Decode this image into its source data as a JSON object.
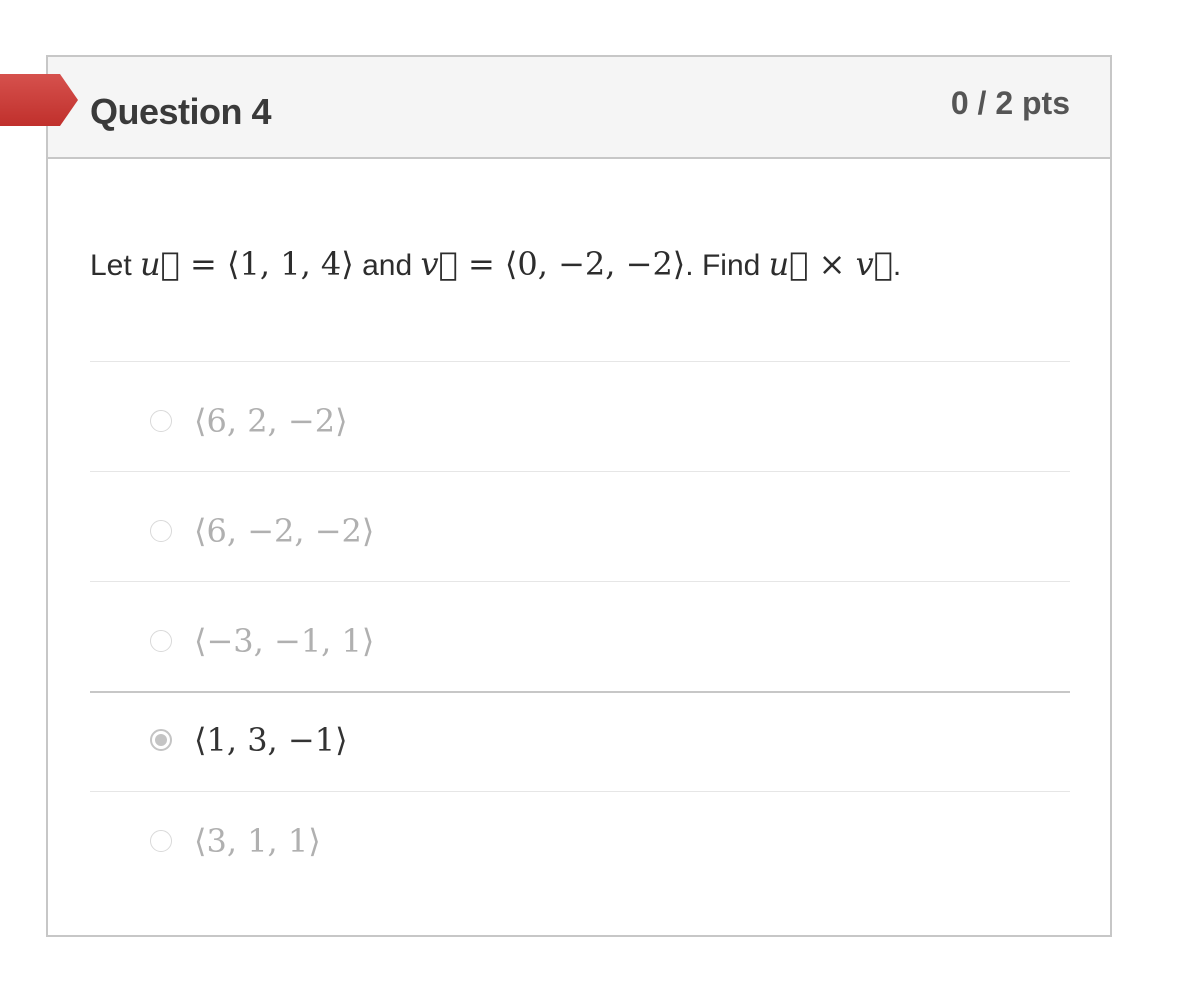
{
  "question": {
    "title": "Question 4",
    "points": "0 / 2 pts",
    "status_color": "#c0302c",
    "prompt": {
      "lead": "Let ",
      "u_symbol": "u⃗",
      "eq1": " = ",
      "u_value": "⟨1, 1, 4⟩",
      "and_text": " and ",
      "v_symbol": "v⃗",
      "eq2": " = ",
      "v_value": "⟨0, −2, −2⟩",
      "find_text": ". Find ",
      "u_symbol2": "u⃗",
      "times": " × ",
      "v_symbol2": "v⃗",
      "end": "."
    }
  },
  "answers": [
    {
      "label": "⟨6, 2, −2⟩",
      "selected": false
    },
    {
      "label": "⟨6, −2, −2⟩",
      "selected": false
    },
    {
      "label": "⟨−3, −1, 1⟩",
      "selected": false
    },
    {
      "label": "⟨1, 3, −1⟩",
      "selected": true
    },
    {
      "label": "⟨3, 1, 1⟩",
      "selected": false
    }
  ]
}
